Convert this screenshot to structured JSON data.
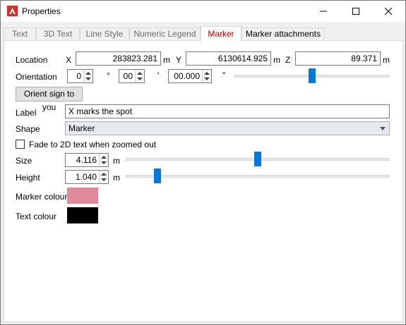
{
  "window": {
    "title": "Properties",
    "controls": {
      "minimize": "minimize",
      "maximize": "maximize",
      "close": "close"
    }
  },
  "tabs": [
    {
      "label": "Text",
      "active": false
    },
    {
      "label": "3D Text",
      "active": false
    },
    {
      "label": "Line Style",
      "active": false
    },
    {
      "label": "Numeric Legend",
      "active": false
    },
    {
      "label": "Marker",
      "active": true
    },
    {
      "label": "Marker attachments",
      "active": false
    }
  ],
  "location": {
    "label": "Location",
    "x_label": "X",
    "x_value": "283823.281",
    "x_unit": "m",
    "y_label": "Y",
    "y_value": "6130614.925",
    "y_unit": "m",
    "z_label": "Z",
    "z_value": "89.371",
    "z_unit": "m"
  },
  "orientation": {
    "label": "Orientation",
    "degrees": "0",
    "degrees_symbol": "°",
    "minutes": "00",
    "minutes_symbol": "'",
    "seconds": "00.000",
    "seconds_symbol": "\"",
    "slider_fraction": 0.5
  },
  "orient_button": "Orient sign to you",
  "label_field": {
    "label": "Label",
    "value": "X marks the spot"
  },
  "shape": {
    "label": "Shape",
    "value": "Marker"
  },
  "fade": {
    "label": "Fade to 2D text when zoomed out",
    "checked": false
  },
  "size": {
    "label": "Size",
    "value": "4.116",
    "unit": "m",
    "slider_fraction": 0.5
  },
  "height": {
    "label": "Height",
    "value": "1.040",
    "unit": "m",
    "slider_fraction": 0.11
  },
  "marker_colour": {
    "label": "Marker colour",
    "color": "#e0899a"
  },
  "text_colour": {
    "label": "Text colour",
    "color": "#000000"
  },
  "colors": {
    "accent": "#0078d7",
    "active_tab": "#c00000",
    "app_icon": "#d32f2f"
  }
}
